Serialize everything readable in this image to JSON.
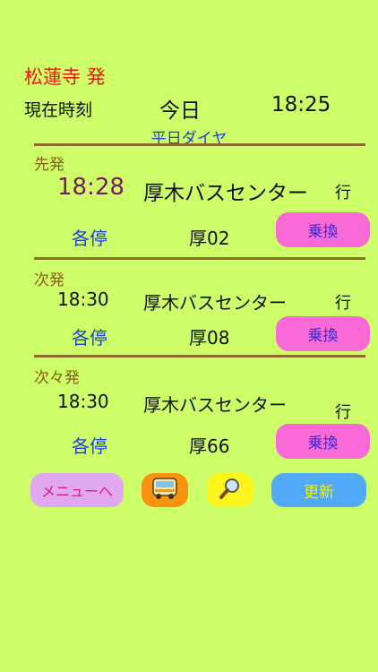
{
  "header": {
    "stop_title": "松蓮寺 発",
    "current_time_label": "現在時刻",
    "day": "今日",
    "time": "18:25",
    "schedule": "平日ダイヤ"
  },
  "departures": [
    {
      "label": "先発",
      "time": "18:28",
      "destination": "厚木バスセンター",
      "bound": "行",
      "service": "各停",
      "route": "厚02",
      "transfer_label": "乗換"
    },
    {
      "label": "次発",
      "time": "18:30",
      "destination": "厚木バスセンター",
      "bound": "行",
      "service": "各停",
      "route": "厚08",
      "transfer_label": "乗換"
    },
    {
      "label": "次々発",
      "time": "18:30",
      "destination": "厚木バスセンター",
      "bound": "行",
      "service": "各停",
      "route": "厚66",
      "transfer_label": "乗換"
    }
  ],
  "toolbar": {
    "menu_label": "メニューへ",
    "bus_icon": "bus-icon",
    "search_icon": "magnifier-icon",
    "refresh_label": "更新"
  },
  "colors": {
    "background": "#cdfe6a",
    "stop_title": "#e61a0e",
    "transfer_button": "#f96ad6",
    "menu_button": "#dfa8f0",
    "bus_button": "#f7930f",
    "search_button": "#fbf51c",
    "refresh_button": "#51a9f8"
  }
}
